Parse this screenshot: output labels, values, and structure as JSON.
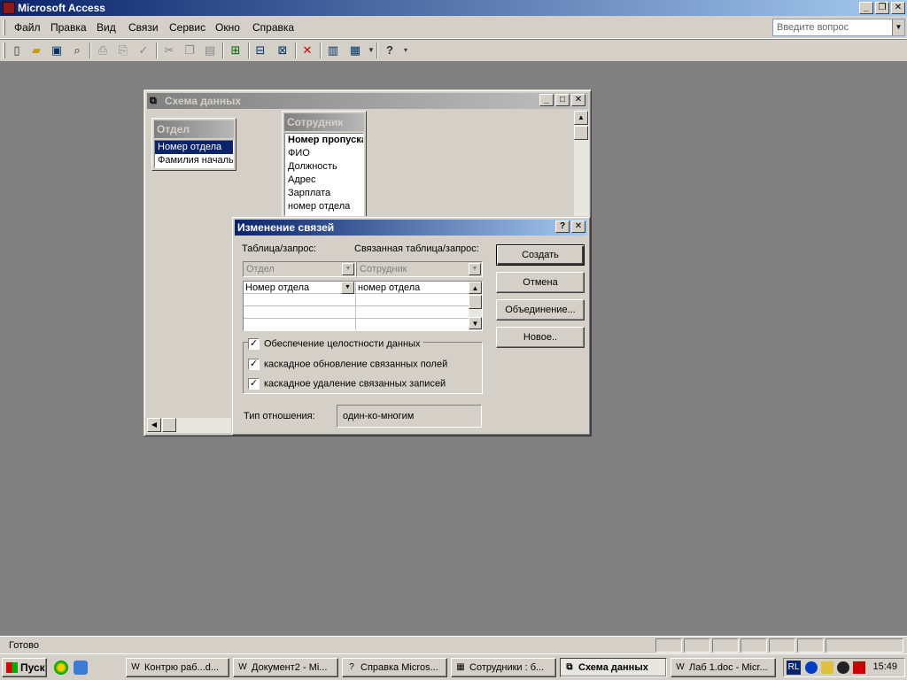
{
  "app": {
    "title": "Microsoft Access"
  },
  "menu": {
    "items": [
      "Файл",
      "Правка",
      "Вид",
      "Связи",
      "Сервис",
      "Окно",
      "Справка"
    ],
    "help_placeholder": "Введите вопрос"
  },
  "toolbar": {
    "icons": [
      "new-icon",
      "open-icon",
      "save-icon",
      "search-file-icon",
      "print-icon",
      "print-preview-icon",
      "spelling-icon",
      "cut-icon",
      "copy-icon",
      "paste-icon",
      "show-table-icon",
      "show-direct-icon",
      "show-all-icon",
      "delete-icon",
      "database-window-icon",
      "new-object-icon",
      "help-icon"
    ]
  },
  "schema_window": {
    "title": "Схема данных",
    "tables": [
      {
        "name": "Отдел",
        "fields": [
          "Номер отдела",
          "Фамилия началь"
        ]
      },
      {
        "name": "Сотрудник",
        "fields": [
          "Номер пропуска",
          "ФИО",
          "Должность",
          "Адрес",
          "Зарплата",
          "номер отдела"
        ]
      }
    ]
  },
  "dialog": {
    "title": "Изменение связей",
    "help_btn": "?",
    "close_btn": "✕",
    "table_label": "Таблица/запрос:",
    "related_label": "Связанная таблица/запрос:",
    "table_value": "Отдел",
    "related_value": "Сотрудник",
    "grid": {
      "left": "Номер отдела",
      "right": "номер отдела"
    },
    "buttons": {
      "create": "Создать",
      "cancel": "Отмена",
      "join": "Объединение...",
      "new": "Новое.."
    },
    "checks": {
      "integrity": "Обеспечение целостности данных",
      "cascade_update": "каскадное обновление связанных полей",
      "cascade_delete": "каскадное удаление связанных записей"
    },
    "check_mark": "✓",
    "rel_type_label": "Тип отношения:",
    "rel_type_value": "один-ко-многим"
  },
  "status": {
    "text": "Готово"
  },
  "taskbar": {
    "start": "Пуск",
    "tasks": [
      "Контрю раб...d...",
      "Документ2 - Mi...",
      "Справка Micros...",
      "Сотрудники : б...",
      "Схема данных",
      "Лаб 1.doc - Micr..."
    ],
    "lang": "RL",
    "clock": "15:49"
  }
}
